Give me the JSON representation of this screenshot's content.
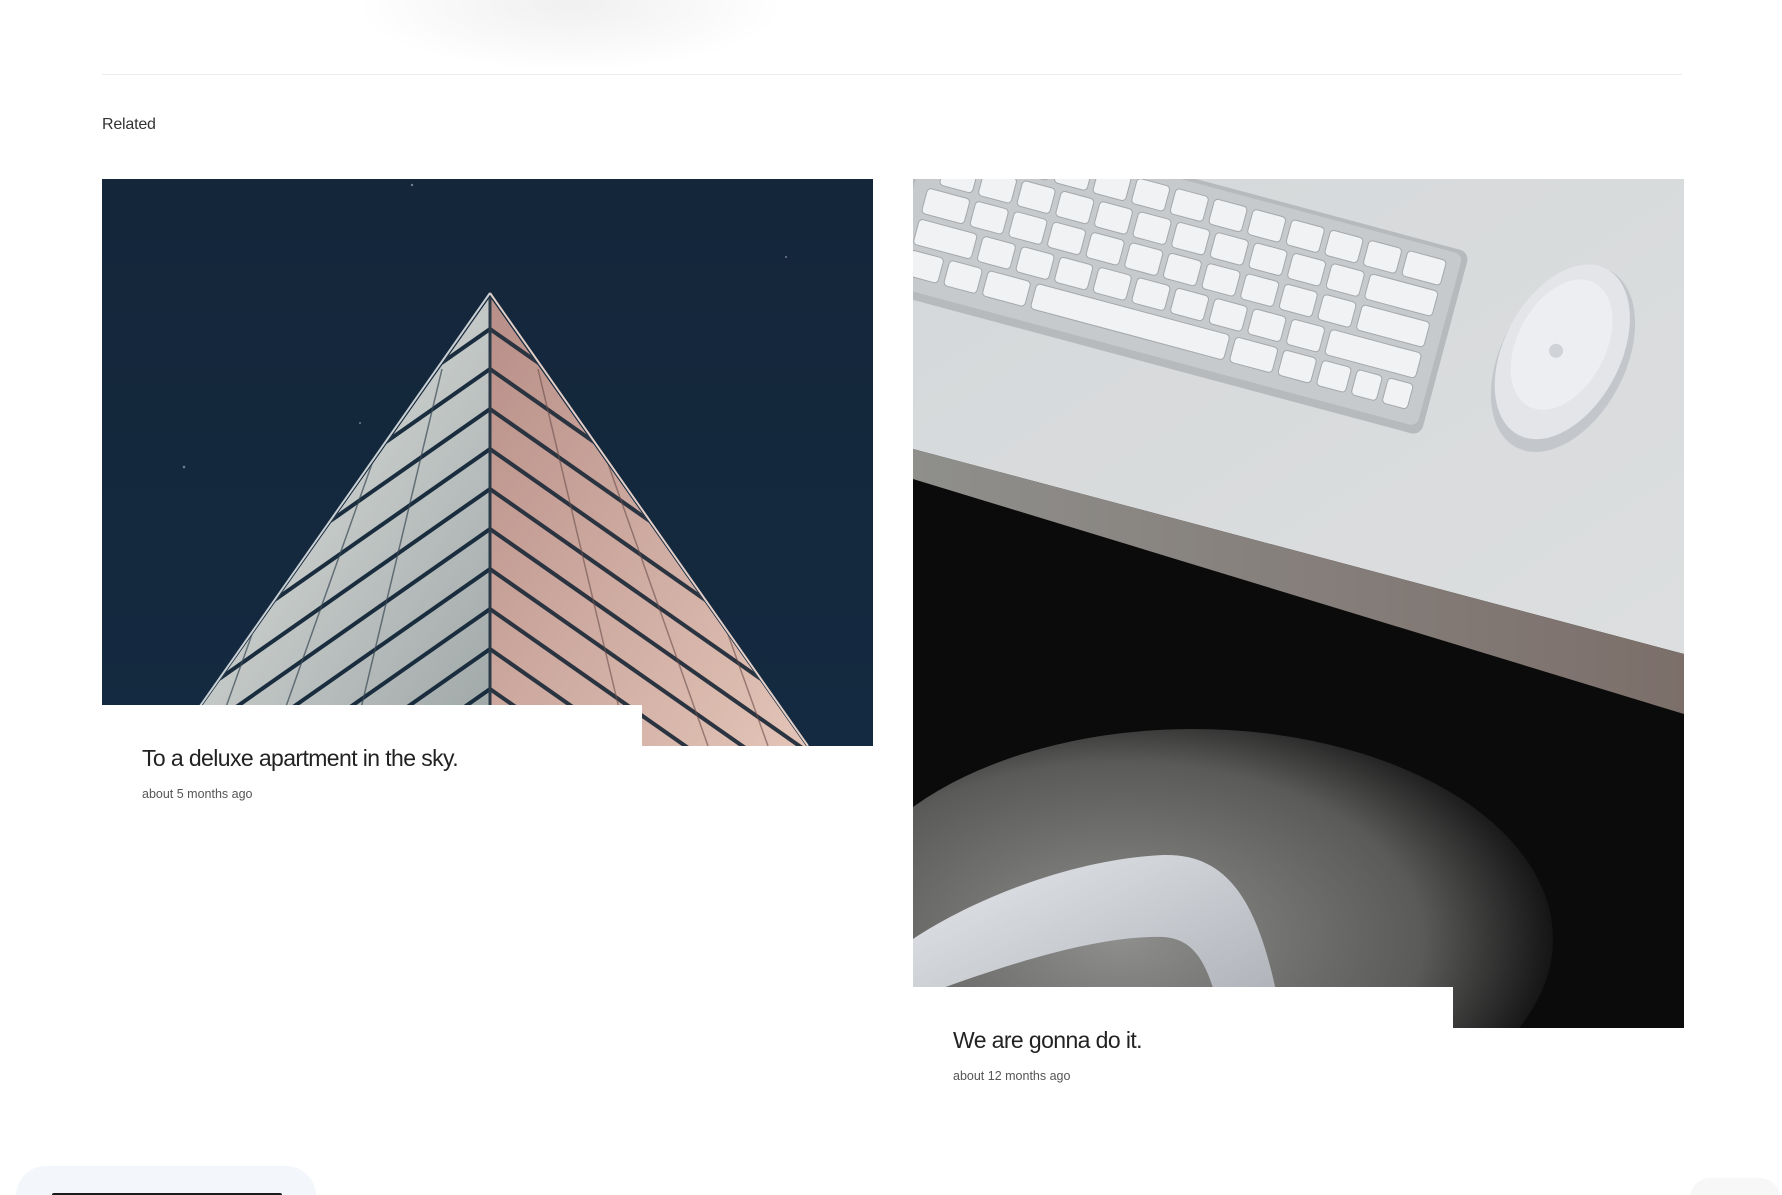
{
  "related": {
    "heading": "Related"
  },
  "cards": [
    {
      "title": "To a deluxe apartment in the sky.",
      "date": "about 5 months ago",
      "image_subject": "triangular-building-night-sky"
    },
    {
      "title": "We are gonna do it.",
      "date": "about 12 months ago",
      "image_subject": "desk-keyboard-mouse-chair"
    }
  ],
  "colors": {
    "page_background": "#ffffff",
    "title_text": "#222222",
    "meta_text": "#555555",
    "divider": "#ececec",
    "night_sky": "#13263b",
    "desk": "#d8dadb"
  }
}
